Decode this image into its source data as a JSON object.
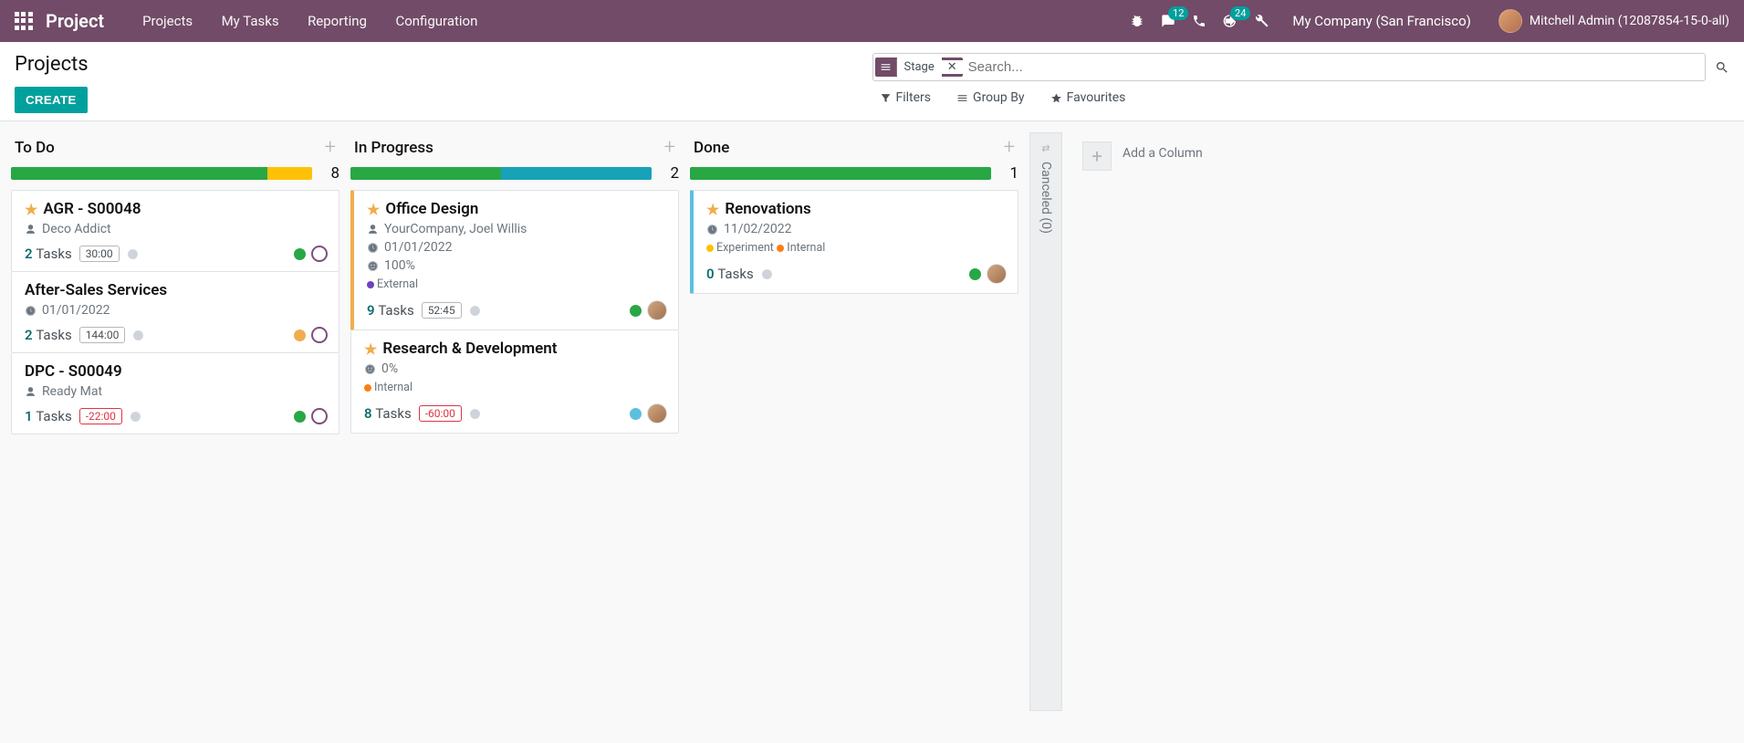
{
  "topnav": {
    "brand": "Project",
    "menu": [
      "Projects",
      "My Tasks",
      "Reporting",
      "Configuration"
    ],
    "messages_badge": "12",
    "activities_badge": "24",
    "company": "My Company (San Francisco)",
    "user": "Mitchell Admin (12087854-15-0-all)"
  },
  "control": {
    "title": "Projects",
    "create": "CREATE",
    "facet_label": "Stage",
    "search_placeholder": "Search...",
    "filters": "Filters",
    "groupby": "Group By",
    "favourites": "Favourites"
  },
  "columns": [
    {
      "title": "To Do",
      "count": "8",
      "progress": [
        {
          "color": "#28a745",
          "pct": 85
        },
        {
          "color": "#ffc107",
          "pct": 15
        }
      ],
      "cards": [
        {
          "edge": "",
          "star": true,
          "title": "AGR - S00048",
          "meta1_icon": "user",
          "meta1": "Deco Addict",
          "tasks_n": "2",
          "tasks_lbl": "Tasks",
          "pill": "30:00",
          "pill_red": false,
          "status_color": "#28a745",
          "face": "purple",
          "avatar": false
        },
        {
          "edge": "",
          "star": false,
          "title": "After-Sales Services",
          "meta1_icon": "clock",
          "meta1": "01/01/2022",
          "tasks_n": "2",
          "tasks_lbl": "Tasks",
          "pill": "144:00",
          "pill_red": false,
          "status_color": "#f0ad4e",
          "face": "purple",
          "avatar": false
        },
        {
          "edge": "",
          "star": false,
          "title": "DPC - S00049",
          "meta1_icon": "user",
          "meta1": "Ready Mat",
          "tasks_n": "1",
          "tasks_lbl": "Tasks",
          "pill": "-22:00",
          "pill_red": true,
          "status_color": "#28a745",
          "face": "purple",
          "avatar": false
        }
      ]
    },
    {
      "title": "In Progress",
      "count": "2",
      "progress": [
        {
          "color": "#28a745",
          "pct": 50
        },
        {
          "color": "#17a2b8",
          "pct": 50
        }
      ],
      "cards": [
        {
          "edge": "yellow",
          "star": true,
          "title": "Office Design",
          "meta1_icon": "user",
          "meta1": "YourCompany, Joel Willis",
          "meta2_icon": "clock",
          "meta2": "01/01/2022",
          "meta3_icon": "smile",
          "meta3": "100%",
          "tags": [
            {
              "color": "#6f42c1",
              "label": "External"
            }
          ],
          "tasks_n": "9",
          "tasks_lbl": "Tasks",
          "pill": "52:45",
          "pill_red": false,
          "status_color": "#28a745",
          "face": "",
          "avatar": true
        },
        {
          "edge": "",
          "star": true,
          "title": "Research & Development",
          "meta1_icon": "smile",
          "meta1": "0%",
          "tags": [
            {
              "color": "#fd7e14",
              "label": "Internal"
            }
          ],
          "tasks_n": "8",
          "tasks_lbl": "Tasks",
          "pill": "-60:00",
          "pill_red": true,
          "status_color": "#5bc0de",
          "face": "",
          "avatar": true
        }
      ]
    },
    {
      "title": "Done",
      "count": "1",
      "progress": [
        {
          "color": "#28a745",
          "pct": 100
        }
      ],
      "cards": [
        {
          "edge": "blue",
          "star": true,
          "title": "Renovations",
          "meta1_icon": "clock",
          "meta1": "11/02/2022",
          "tags": [
            {
              "color": "#ffc107",
              "label": "Experiment"
            },
            {
              "color": "#fd7e14",
              "label": "Internal"
            }
          ],
          "tasks_n": "0",
          "tasks_lbl": "Tasks",
          "pill": "",
          "pill_red": false,
          "status_color": "#28a745",
          "face": "",
          "avatar": true
        }
      ]
    }
  ],
  "collapsed": {
    "label": "Canceled (0)"
  },
  "add_column": "Add a Column"
}
